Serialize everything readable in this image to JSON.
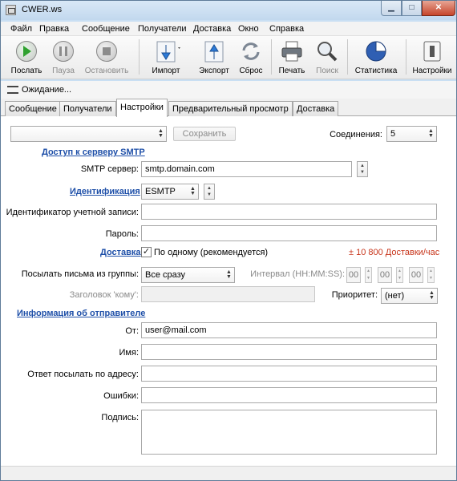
{
  "window": {
    "title": "CWER.ws"
  },
  "menu": [
    "Файл",
    "Правка",
    "Сообщение",
    "Получатели",
    "Доставка",
    "Окно",
    "Справка"
  ],
  "toolbar": {
    "send": "Послать",
    "pause": "Пауза",
    "stop": "Остановить",
    "import": "Импорт",
    "export": "Экспорт",
    "reset": "Сброс",
    "print": "Печать",
    "search": "Поиск",
    "stats": "Статистика",
    "settings": "Настройки"
  },
  "status": {
    "text": "Ожидание..."
  },
  "tabs": [
    "Сообщение",
    "Получатели",
    "Настройки",
    "Предварительный просмотр",
    "Доставка"
  ],
  "settings": {
    "profile_value": "",
    "save_label": "Сохранить",
    "connections_label": "Соединения:",
    "connections_value": "5",
    "smtp_section": "Доступ к серверу SMTP",
    "smtp_server_label": "SMTP сервер:",
    "smtp_server_value": "smtp.domain.com",
    "auth_link": "Идентификация",
    "auth_value": "ESMTP",
    "account_label": "Идентификатор учетной записи:",
    "account_value": "",
    "password_label": "Пароль:",
    "password_value": "",
    "delivery_link": "Доставка",
    "one_by_one_label": "По одному (рекомендуется)",
    "one_by_one_checked": true,
    "delivery_rate": "± 10 800 Доставки/час",
    "group_send_label": "Посылать письма из группы:",
    "group_send_value": "Все сразу",
    "interval_label": "Интервал (HH:MM:SS):",
    "interval": [
      "00",
      "00",
      "00"
    ],
    "to_header_label": "Заголовок 'кому':",
    "to_header_value": "",
    "priority_label": "Приоритет:",
    "priority_value": "(нет)",
    "sender_section": "Информация об отправителе",
    "from_label": "От:",
    "from_value": "user@mail.com",
    "name_label": "Имя:",
    "name_value": "",
    "reply_to_label": "Ответ посылать по адресу:",
    "reply_to_value": "",
    "errors_label": "Ошибки:",
    "errors_value": "",
    "signature_label": "Подпись:",
    "signature_value": ""
  },
  "colors": {
    "link": "#1e4fa8",
    "rate": "#c8361c",
    "window_frame": "#c9dff3"
  },
  "icons": [
    "app-icon",
    "play-icon",
    "pause-icon",
    "stop-icon",
    "import-icon",
    "export-icon",
    "reset-icon",
    "print-icon",
    "search-icon",
    "stats-icon",
    "settings-icon",
    "waiting-icon"
  ]
}
